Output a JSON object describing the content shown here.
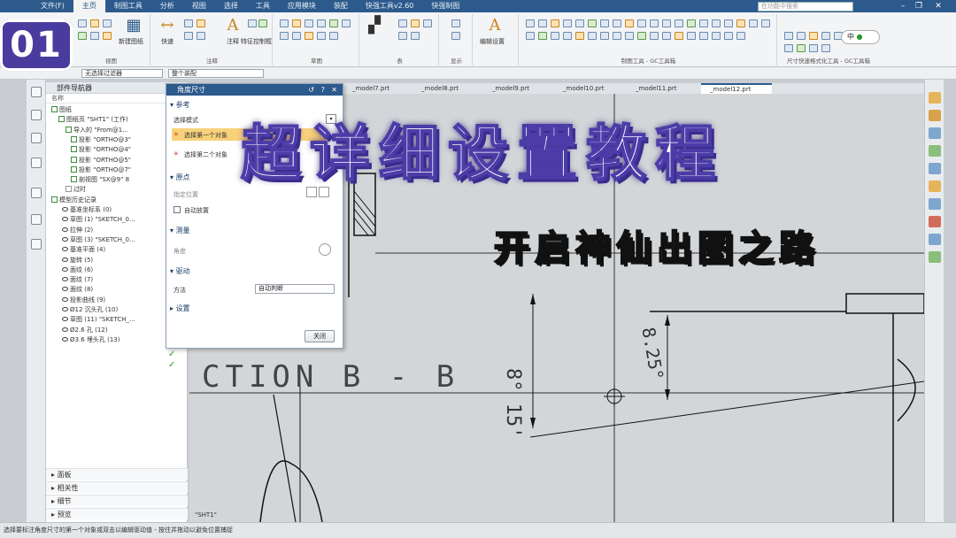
{
  "menubar": {
    "items": [
      "文件(F)",
      "主页",
      "制图工具",
      "分析",
      "视图",
      "选择",
      "工具",
      "应用模块",
      "装配",
      "快强工具v2.60",
      "快强制图"
    ],
    "active_index": 1,
    "search_placeholder": "在功能中搜索"
  },
  "ribbon": {
    "groups": [
      "视图",
      "注释",
      "草图",
      "表",
      "显示",
      "制图工具 - GC工具箱",
      "尺寸快速格式化工具 - GC工具箱"
    ],
    "labels": {
      "new_sheet": "新建图纸",
      "quick": "快速",
      "note": "注释",
      "feature_frame": "特征控制框",
      "sketch": "草图",
      "table": "表格",
      "display": "编辑设置"
    },
    "ime": "中"
  },
  "toolbar2": {
    "filter": "无选择过滤器",
    "scope": "整个装配"
  },
  "logo": {
    "text": "01"
  },
  "navigator": {
    "title": "部件导航器",
    "column": "名称",
    "rows": [
      {
        "label": "图纸",
        "kind": "check"
      },
      {
        "label": "图纸页 \"SHT1\" (工作)",
        "kind": "check"
      },
      {
        "label": "导入的 \"From@1...",
        "kind": "check"
      },
      {
        "label": "投影 \"ORTHO@3\"",
        "kind": "check"
      },
      {
        "label": "投影 \"ORTHO@4\"",
        "kind": "check"
      },
      {
        "label": "投影 \"ORTHO@5\"",
        "kind": "check"
      },
      {
        "label": "投影 \"ORTHO@7\"",
        "kind": "check"
      },
      {
        "label": "剖视图 \"SX@9\" 8",
        "kind": "check"
      },
      {
        "label": "过时",
        "kind": "plain"
      },
      {
        "label": "模型历史记录",
        "kind": "check"
      },
      {
        "label": "基准坐标系 (0)",
        "kind": "eye"
      },
      {
        "label": "草图 (1) \"SKETCH_0...",
        "kind": "eye"
      },
      {
        "label": "拉伸 (2)",
        "kind": "eye"
      },
      {
        "label": "草图 (3) \"SKETCH_0...",
        "kind": "eye"
      },
      {
        "label": "基准平面 (4)",
        "kind": "eye"
      },
      {
        "label": "旋转 (5)",
        "kind": "eye"
      },
      {
        "label": "面纹 (6)",
        "kind": "eye"
      },
      {
        "label": "面纹 (7)",
        "kind": "eye"
      },
      {
        "label": "面纹 (8)",
        "kind": "eye"
      },
      {
        "label": "投影曲线 (9)",
        "kind": "eye"
      },
      {
        "label": "Ø12 沉头孔 (10)",
        "kind": "eye"
      },
      {
        "label": "草图 (11) \"SKETCH_...",
        "kind": "eye"
      },
      {
        "label": "Ø2.6 孔 (12)",
        "kind": "eye"
      },
      {
        "label": "Ø3.6 埋头孔 (13)",
        "kind": "eye"
      }
    ],
    "sections": [
      "面板",
      "相关性",
      "细节",
      "预览"
    ]
  },
  "dialog": {
    "title": "角度尺寸",
    "sections": {
      "reference": "参考",
      "origin": "原点",
      "measure": "测量",
      "driving": "驱动",
      "settings": "设置"
    },
    "select_mode_label": "选择模式",
    "select_mode_value": "",
    "first_object": "选择第一个对象",
    "second_object": "选择第二个对象",
    "specify_location": "指定位置",
    "auto_place": "自动放置",
    "measure_method": "角度",
    "driving_method_label": "方法",
    "driving_method_value": "自动判断",
    "close_button": "关闭"
  },
  "tabs": [
    "_model7.prt",
    "_model8.prt",
    "_model9.prt",
    "_model10.prt",
    "_model11.prt",
    "_model12.prt"
  ],
  "active_tab": 5,
  "drawing": {
    "section_label": "CTION  B - B",
    "dim1": "8° 15'",
    "dim2": "8.25°",
    "sheet_label": "\"SHT1\""
  },
  "overlay": {
    "title": "超详细设置教程",
    "subtitle": "开启神仙出图之路"
  },
  "statusbar": {
    "text": "选择要标注角度尺寸的第一个对象或双击以编辑驱动值 - 按住并拖动以避免位置捕捉"
  },
  "colors": {
    "menubar": "#2d5a8c",
    "logo": "#4a3b9e",
    "title_outline": "#4d3ca8",
    "subtitle": "#ffe65a",
    "tick": "#2a9a2a"
  }
}
